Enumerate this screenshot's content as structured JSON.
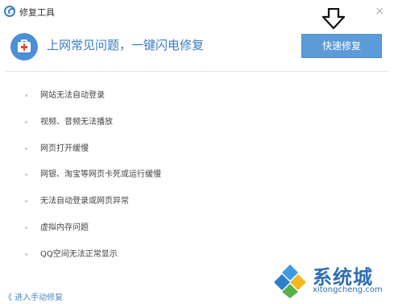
{
  "window": {
    "title": "修复工具",
    "close_symbol": "×"
  },
  "header": {
    "headline": "上网常见问题，一键闪电修复",
    "repair_button": "快速修复",
    "icon": "first-aid-kit-icon"
  },
  "issues": [
    "网站无法自动登录",
    "视频、音频无法播放",
    "网页打开缓慢",
    "网银、淘宝等网页卡死或运行缓慢",
    "无法自动登录或网页异常",
    "虚拟内存问题",
    "QQ空间无法正常显示"
  ],
  "footer": {
    "manual_link": "《 进入手动修复"
  },
  "watermark": {
    "brand": "系统城",
    "site": "xitongcheng.com"
  },
  "colors": {
    "accent": "#3b7cc4",
    "button": "#5b9bd8",
    "kit_red": "#e0463c"
  }
}
